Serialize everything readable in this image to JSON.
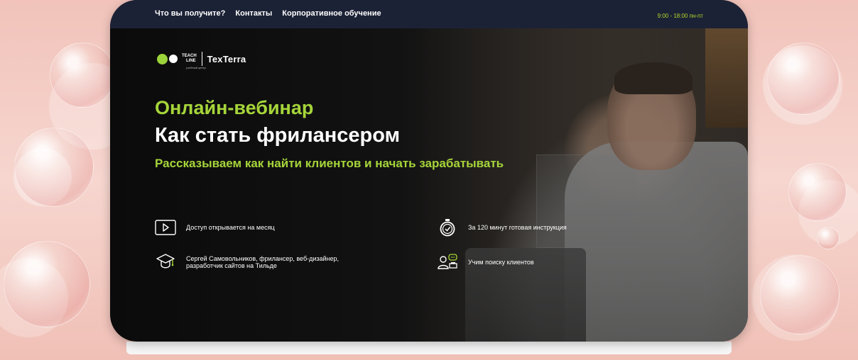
{
  "topbar": {
    "nav": [
      "Что вы получите?",
      "Контакты",
      "Корпоративное обучение"
    ],
    "hours": "9:00 - 18:00 пн-пт"
  },
  "logo": {
    "teach": "TEACH",
    "line": "LINE",
    "subtitle": "учебный центр",
    "brand": "TexTerra"
  },
  "hero": {
    "title_line1": "Онлайн-вебинар",
    "title_line2": "Как стать фрилансером",
    "subtitle": "Рассказываем как найти клиентов и начать зарабатывать"
  },
  "features": [
    {
      "icon": "play-icon",
      "text": "Доступ открывается на месяц"
    },
    {
      "icon": "stopwatch-icon",
      "text": "За 120 минут готовая инструкция"
    },
    {
      "icon": "graduation-cap-icon",
      "text": "Сергей Самовольников, фрилансер, веб-дизайнер, разработчик сайтов на Тильде"
    },
    {
      "icon": "user-chat-icon",
      "text": "Учим поиску клиентов"
    }
  ],
  "colors": {
    "accent": "#a6d53a",
    "topbar": "#1c2236",
    "background": "#f3cdc6"
  }
}
